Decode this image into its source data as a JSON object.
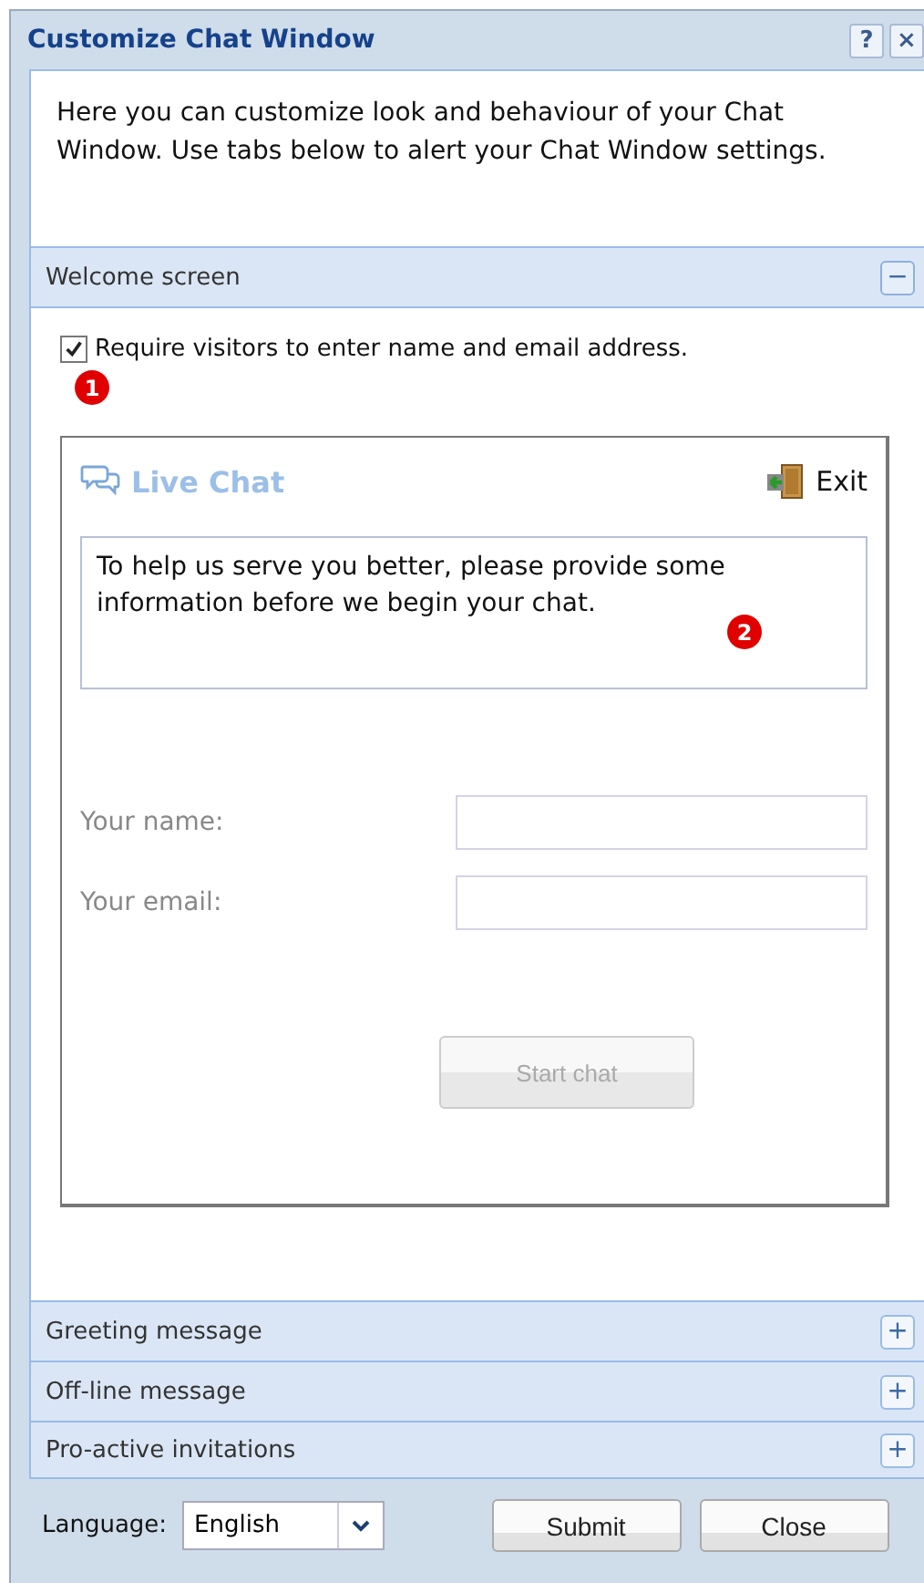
{
  "window": {
    "title": "Customize Chat Window",
    "buttons": [
      "?",
      "×"
    ]
  },
  "intro": "Here you can customize look and behaviour of your Chat Window. Use tabs below to alert your Chat Window settings.",
  "sections": [
    {
      "title": "Welcome screen",
      "expanded": true,
      "toggle": "−"
    },
    {
      "title": "Greeting message",
      "expanded": false,
      "toggle": "+"
    },
    {
      "title": "Off-line message",
      "expanded": false,
      "toggle": "+"
    },
    {
      "title": "Pro-active invitations",
      "expanded": false,
      "toggle": "+"
    }
  ],
  "welcome": {
    "require_checkbox": {
      "label": "Require visitors to enter name and email address.",
      "checked": true
    },
    "markers": [
      "1",
      "2"
    ],
    "preview": {
      "title": "Live Chat",
      "exit": "Exit",
      "message": "To help us serve you better, please provide some information before we begin your chat.",
      "fields": [
        {
          "label": "Your name:"
        },
        {
          "label": "Your email:"
        }
      ],
      "start_button": {
        "label": "Start chat",
        "disabled": true
      }
    }
  },
  "footer": {
    "language_label": "Language:",
    "language_value": "English",
    "buttons": [
      "Submit",
      "Close"
    ]
  }
}
